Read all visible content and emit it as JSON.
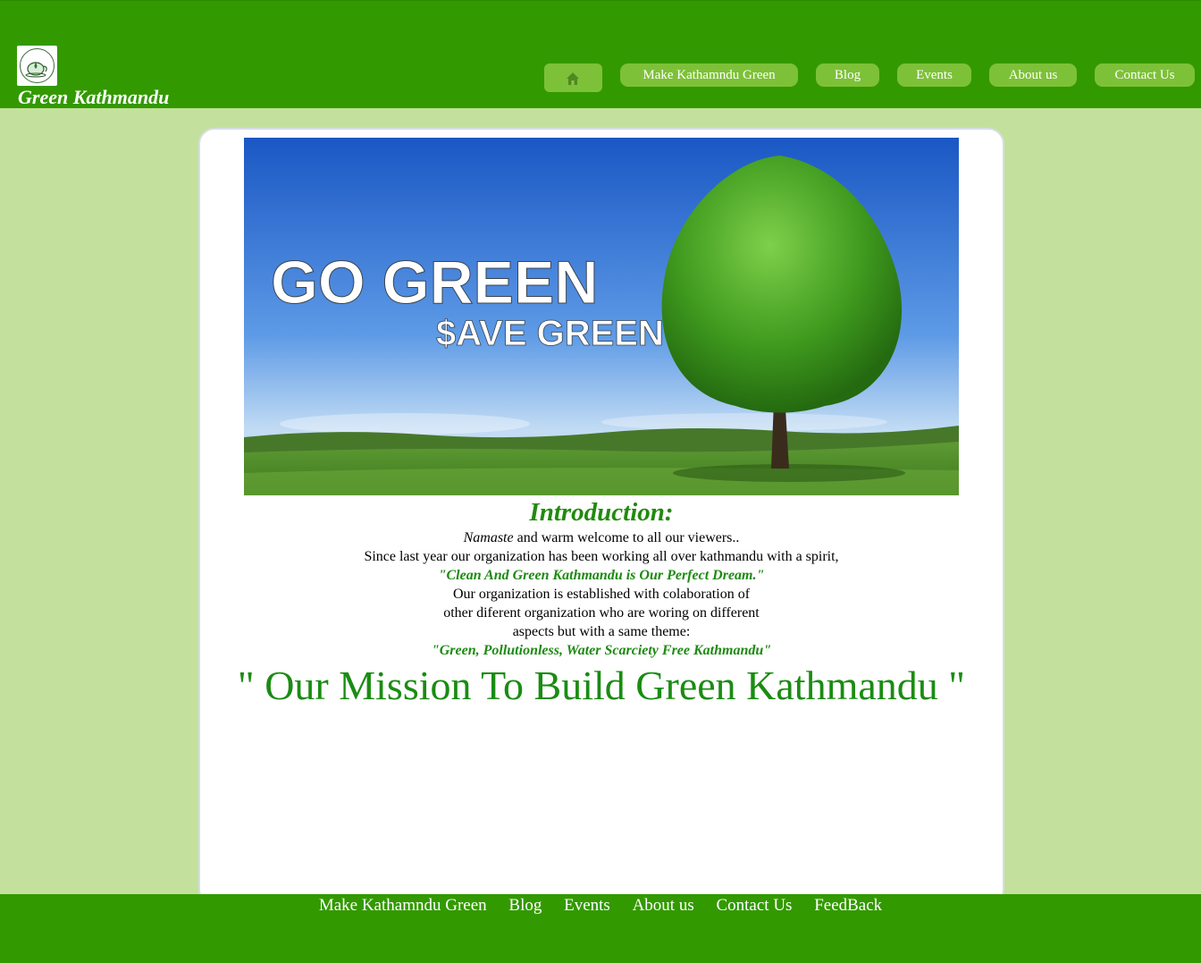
{
  "site": {
    "title": "Green Kathmandu",
    "logo_icon": "teacup-leaf-logo-icon"
  },
  "nav": {
    "home_icon": "home-icon",
    "items": [
      {
        "label": "Make Kathamndu Green"
      },
      {
        "label": "Blog"
      },
      {
        "label": "Events"
      },
      {
        "label": "About us"
      },
      {
        "label": "Contact Us"
      }
    ]
  },
  "banner": {
    "line1": "GO GREEN",
    "line2": "$AVE GREEN"
  },
  "intro": {
    "heading": "Introduction:",
    "greeting_italic": "Namaste",
    "greeting_rest": " and warm welcome to all our viewers..",
    "line2": "Since last year our organization has been working all over kathmandu with a spirit,",
    "quote1": "\"Clean And Green Kathmandu is Our Perfect Dream.\"",
    "line4": "Our organization is established with colaboration of",
    "line5": "other diferent organization who are woring on different",
    "line6": "aspects but with a same theme:",
    "quote2": "\"Green, Pollutionless, Water Scarciety Free Kathmandu\""
  },
  "mission": "\" Our Mission To Build Green Kathmandu \"",
  "footer": {
    "links": [
      {
        "label": "Make Kathamndu Green"
      },
      {
        "label": "Blog"
      },
      {
        "label": "Events"
      },
      {
        "label": "About us"
      },
      {
        "label": "Contact Us"
      },
      {
        "label": "FeedBack"
      }
    ]
  },
  "colors": {
    "header_bg": "#339900",
    "page_bg": "#c3e19c",
    "nav_button": "#7dc138",
    "accent_green": "#1a8c12"
  }
}
